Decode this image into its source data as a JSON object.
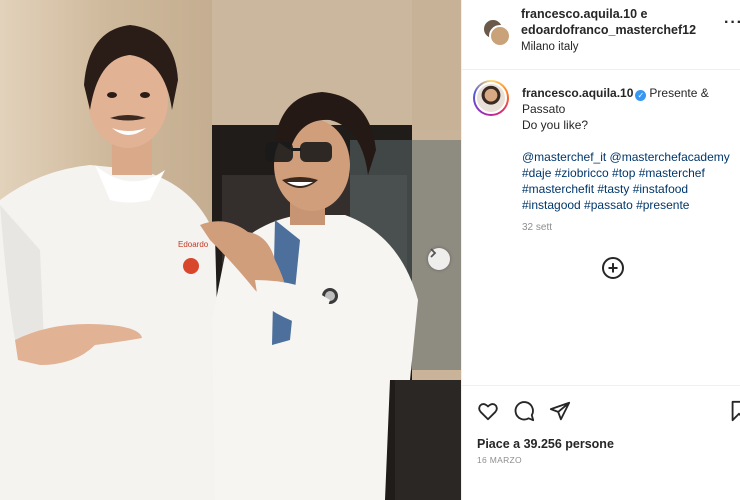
{
  "post": {
    "header": {
      "users_line1": "francesco.aquila.10 e",
      "users_line2": "edoardofranco_masterchef12",
      "location": "Milano italy",
      "more_label": "···"
    },
    "caption": {
      "username": "francesco.aquila.10",
      "verified_glyph": "✓",
      "text_line1": "Presente &",
      "text_line2": "Passato",
      "text_line3": "Do you like?",
      "tags_line1": "@masterchef_it @masterchefacademy",
      "tags_line2": "#daje #ziobricco #top #masterchef",
      "tags_line3": "#masterchefit #tasty #instafood",
      "tags_line4": "#instagood #passato #presente",
      "time_ago": "32 sett"
    },
    "photo": {
      "jacket_name": "Edoardo"
    },
    "add_comment_glyph": "+",
    "likes_text": "Piace a 39.256 persone",
    "date": "16 MARZO",
    "icons": [
      "heart-icon",
      "comment-icon",
      "share-icon",
      "bookmark-icon",
      "chevron-right-icon",
      "add-circle-icon",
      "more-icon"
    ],
    "colors": {
      "link": "#00376b",
      "verified": "#3897f0",
      "muted": "#8e8e8e"
    }
  }
}
